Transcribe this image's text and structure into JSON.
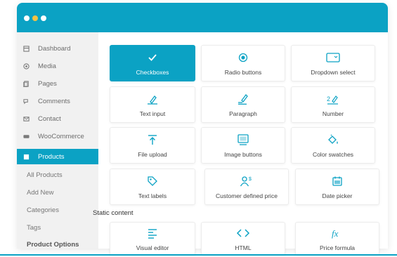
{
  "colors": {
    "accent": "#0ba2c4",
    "dot_yellow": "#f5c242"
  },
  "sidebar": {
    "items": [
      {
        "label": "Dashboard",
        "icon": "dashboard-icon"
      },
      {
        "label": "Media",
        "icon": "media-icon"
      },
      {
        "label": "Pages",
        "icon": "pages-icon"
      },
      {
        "label": "Comments",
        "icon": "comments-icon"
      },
      {
        "label": "Contact",
        "icon": "contact-icon"
      },
      {
        "label": "WooCommerce",
        "icon": "woocommerce-icon"
      },
      {
        "label": "Products",
        "icon": "products-icon",
        "active": true
      }
    ],
    "submenu": [
      "All Products",
      "Add New",
      "Categories",
      "Tags",
      "Product Options"
    ]
  },
  "fields": [
    {
      "label": "Checkboxes",
      "icon": "checkmark-icon",
      "selected": true
    },
    {
      "label": "Radio buttons",
      "icon": "radio-icon"
    },
    {
      "label": "Dropdown select",
      "icon": "dropdown-icon"
    },
    {
      "label": "Text input",
      "icon": "text-input-icon"
    },
    {
      "label": "Paragraph",
      "icon": "paragraph-icon"
    },
    {
      "label": "Number",
      "icon": "number-icon"
    },
    {
      "label": "File upload",
      "icon": "upload-icon"
    },
    {
      "label": "Image buttons",
      "icon": "image-icon"
    },
    {
      "label": "Color swatches",
      "icon": "paint-bucket-icon"
    },
    {
      "label": "Text labels",
      "icon": "tag-icon"
    },
    {
      "label": "Customer defined price",
      "icon": "customer-price-icon"
    },
    {
      "label": "Date picker",
      "icon": "calendar-icon"
    }
  ],
  "static_section": {
    "title": "Static content",
    "fields": [
      {
        "label": "Visual editor",
        "icon": "visual-editor-icon"
      },
      {
        "label": "HTML",
        "icon": "code-icon"
      },
      {
        "label": "Price formula",
        "icon": "fx-icon"
      }
    ]
  }
}
